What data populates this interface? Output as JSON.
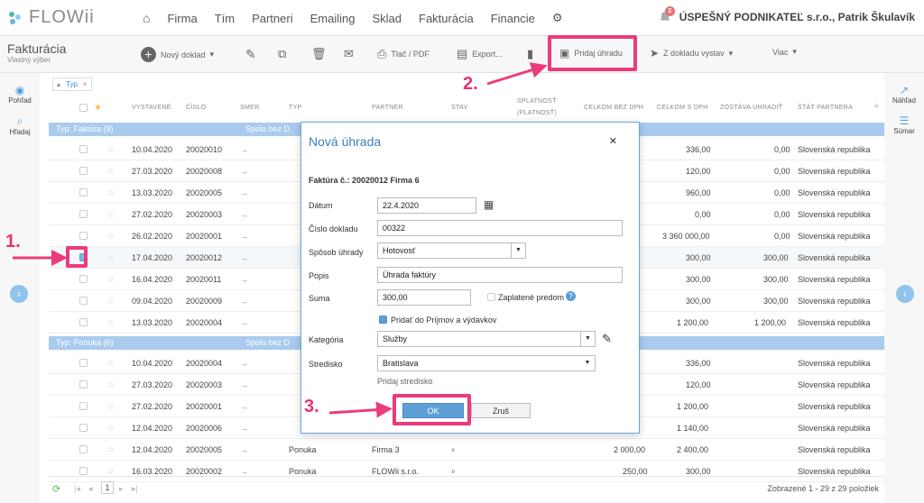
{
  "app": {
    "logo": "FLOWii"
  },
  "nav": [
    "Firma",
    "Tím",
    "Partneri",
    "Emailing",
    "Sklad",
    "Fakturácia",
    "Financie"
  ],
  "company": {
    "name": "ÚSPEŠNÝ PODNIKATEĽ s.r.o., Patrik Škulavík",
    "notifications": "2"
  },
  "page": {
    "title": "Fakturácia",
    "subtitle": "Vlastný výber"
  },
  "toolbar": {
    "new_doc": "Nový doklad",
    "print": "Tlač / PDF",
    "export": "Export...",
    "add_payment": "Pridaj úhradu",
    "from_doc": "Z dokladu vystav",
    "more": "Viac"
  },
  "left": {
    "view": "Pohľad",
    "search": "Hľadaj"
  },
  "right": {
    "preview": "Náhľad",
    "summary": "Súmar"
  },
  "filter": {
    "tag": "Typ"
  },
  "columns": [
    "VYSTAVENÉ",
    "ČÍSLO",
    "SMER",
    "TYP",
    "PARTNER",
    "STAV",
    "SPLATNOSŤ",
    "(PLATNOSŤ)",
    "CELKOM BEZ DPH",
    "CELKOM S DPH",
    "ZOSTÁVA UHRADIŤ",
    "ŠTÁT PARTNERA"
  ],
  "groups": [
    {
      "label": "Typ: Faktúra (9)",
      "sum": "Spolu bez D"
    },
    {
      "label": "Typ: Ponuka (6)",
      "sum": "Spolu bez D"
    }
  ],
  "rows_invoice": [
    {
      "date": "10.04.2020",
      "num": "20020010",
      "total": "336,00",
      "remain": "0,00",
      "country": "Slovenská republika"
    },
    {
      "date": "27.03.2020",
      "num": "20020008",
      "total": "120,00",
      "remain": "0,00",
      "country": "Slovenská republika"
    },
    {
      "date": "13.03.2020",
      "num": "20020005",
      "total": "960,00",
      "remain": "0,00",
      "country": "Slovenská republika"
    },
    {
      "date": "27.02.2020",
      "num": "20020003",
      "total": "0,00",
      "remain": "0,00",
      "country": "Slovenská republika"
    },
    {
      "date": "26.02.2020",
      "num": "20020001",
      "total": "3 360 000,00",
      "remain": "0,00",
      "country": "Slovenská republika"
    },
    {
      "date": "17.04.2020",
      "num": "20020012",
      "total": "300,00",
      "remain": "300,00",
      "country": "Slovenská republika"
    },
    {
      "date": "16.04.2020",
      "num": "20020011",
      "total": "300,00",
      "remain": "300,00",
      "country": "Slovenská republika"
    },
    {
      "date": "09.04.2020",
      "num": "20020009",
      "total": "300,00",
      "remain": "300,00",
      "country": "Slovenská republika"
    },
    {
      "date": "13.03.2020",
      "num": "20020004",
      "total": "1 200,00",
      "remain": "1 200,00",
      "country": "Slovenská republika"
    }
  ],
  "rows_offer": [
    {
      "date": "10.04.2020",
      "num": "20020004",
      "total": "336,00",
      "country": "Slovenská republika"
    },
    {
      "date": "27.03.2020",
      "num": "20020003",
      "total": "120,00",
      "country": "Slovenská republika"
    },
    {
      "date": "27.02.2020",
      "num": "20020001",
      "total": "1 200,00",
      "country": "Slovenská republika"
    },
    {
      "date": "12.04.2020",
      "num": "20020006",
      "total": "1 140,00",
      "country": "Slovenská republika"
    },
    {
      "date": "12.04.2020",
      "num": "20020005",
      "type": "Ponuka",
      "partner": "Firma 3",
      "net": "2 000,00",
      "total": "2 400,00",
      "country": "Slovenská republika"
    },
    {
      "date": "16.03.2020",
      "num": "20020002",
      "type": "Ponuka",
      "partner": "FLOWii s.r.o.",
      "net": "250,00",
      "total": "300,00",
      "country": "Slovenská republika"
    }
  ],
  "footer": {
    "page": "1",
    "info": "Zobrazené 1 - 29 z 29 položiek"
  },
  "modal": {
    "title": "Nová úhrada",
    "invoice": "Faktúra č.: 20020012 Firma 6",
    "date_label": "Dátum",
    "date": "22.4.2020",
    "docnum_label": "Číslo dokladu",
    "docnum": "00322",
    "method_label": "Spôsob úhrady",
    "method": "Hotovosť",
    "desc_label": "Popis",
    "desc": "Úhrada faktúry",
    "amount_label": "Suma",
    "amount": "300,00",
    "prepaid_label": "Zaplatené predom",
    "add_ledger_label": "Pridať do Príjmov a výdavkov",
    "category_label": "Kategória",
    "category": "Služby",
    "center_label": "Stredisko",
    "center": "Bratislava",
    "add_center": "Pridaj stredisko",
    "ok": "OK",
    "cancel": "Zruš"
  },
  "annotations": [
    "1.",
    "2.",
    "3."
  ],
  "colors": {
    "accent": "#3a7fc1",
    "pink": "#ec3b7b",
    "group": "#a9cbee"
  }
}
